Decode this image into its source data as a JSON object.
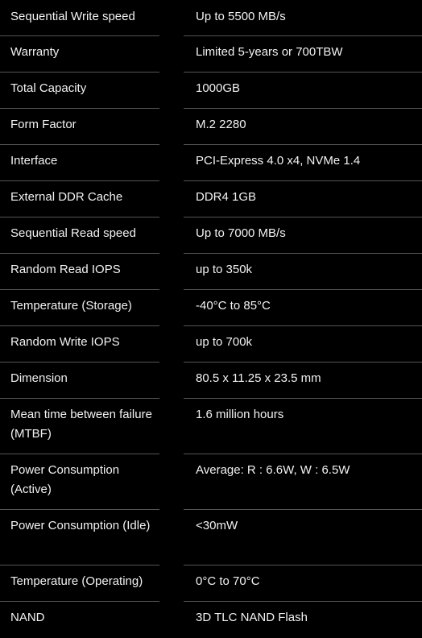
{
  "specs": [
    {
      "label": "Sequential Write speed",
      "value": "Up to 5500 MB/s"
    },
    {
      "label": "Warranty",
      "value": "Limited 5-years or 700TBW"
    },
    {
      "label": "Total Capacity",
      "value": "1000GB"
    },
    {
      "label": "Form Factor",
      "value": "M.2 2280"
    },
    {
      "label": "Interface",
      "value": "PCI-Express 4.0 x4, NVMe 1.4"
    },
    {
      "label": "External DDR Cache",
      "value": "DDR4 1GB"
    },
    {
      "label": "Sequential Read speed",
      "value": "Up to 7000 MB/s"
    },
    {
      "label": "Random Read IOPS",
      "value": "up to 350k"
    },
    {
      "label": "Temperature (Storage)",
      "value": "-40°C to 85°C"
    },
    {
      "label": "Random Write IOPS",
      "value": "up to 700k"
    },
    {
      "label": "Dimension",
      "value": "80.5 x 11.25 x 23.5 mm"
    },
    {
      "label": "Mean time between failure (MTBF)",
      "value": "1.6 million hours"
    },
    {
      "label": "Power Consumption (Active)",
      "value": "Average: R : 6.6W, W : 6.5W"
    },
    {
      "label": "Power Consumption (Idle)",
      "value": "<30mW"
    },
    {
      "label": "Temperature (Operating)",
      "value": "0°C to 70°C"
    },
    {
      "label": "NAND",
      "value": "3D TLC NAND Flash"
    }
  ]
}
